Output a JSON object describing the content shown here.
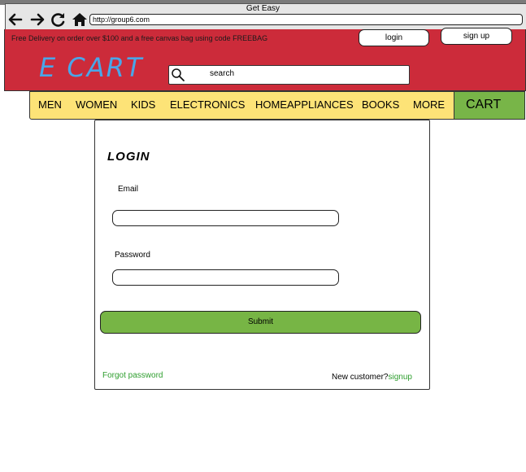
{
  "window": {
    "title": "Get Easy",
    "url": "http://group6.com"
  },
  "header": {
    "promo": "Free Delivery on order over $100 and a free canvas bag using code FREEBAG",
    "login_label": "login",
    "signup_label": "sign up",
    "logo": "E CART",
    "search_placeholder": "search"
  },
  "nav": {
    "items": [
      "MEN",
      "WOMEN",
      "KIDS",
      "ELECTRONICS",
      "HOMEAPPLIANCES",
      "BOOKS",
      "MORE"
    ],
    "cart_label": "CART"
  },
  "login_form": {
    "title": "LOGIN",
    "email_label": "Email",
    "email_value": "",
    "password_label": "Password",
    "password_value": "",
    "submit_label": "Submit",
    "forgot_label": "Forgot password",
    "new_customer_label": "New customer?",
    "signup_link": "signup"
  },
  "colors": {
    "header": "#cc2b3a",
    "nav": "#fde377",
    "cart": "#78b548",
    "submit": "#77b545",
    "logo": "#4aa6e8",
    "link": "#2e9e2e"
  }
}
